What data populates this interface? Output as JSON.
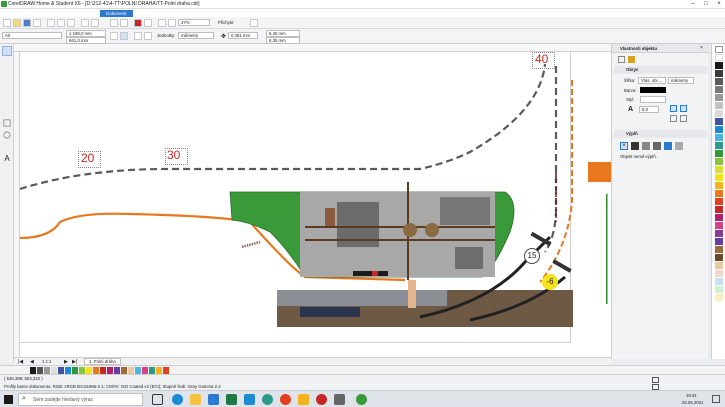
{
  "titlebar": {
    "title": "CorelDRAW Home & Student X6 - [D:\\212-41\\4-TT\\POLNI DRAHA\\TT-Polni draha.cdr]"
  },
  "tabs": {
    "active": "Dokument"
  },
  "toolbar1": {
    "zoom": "37%",
    "snap": "Přichytit"
  },
  "toolbar2": {
    "page_size": "A0",
    "width": "1 189,0 mm",
    "height": "841,0 mm",
    "units_label": "Jednotky:",
    "units": "milimetry",
    "nudge": "0,381 mm",
    "dup_x": "6,35 mm",
    "dup_y": "6,35 mm"
  },
  "canvas": {
    "labels": [
      "20",
      "30",
      "40"
    ],
    "markers": [
      "15",
      "-6"
    ]
  },
  "docker": {
    "title": "Vlastnosti objektu",
    "section_outline": "Obrys",
    "width_label": "Šířka:",
    "width_value": "Vlas. obr....",
    "width_units": "milimetry",
    "color_label": "Barva:",
    "style_label": "Styl:",
    "miter_value": "5,0",
    "section_fill": "Výplň",
    "fill_note": "Objekt nemá výplň."
  },
  "pagetabs": {
    "counter": "1 z 1",
    "page_label": "1: Polní dráha"
  },
  "statusbar": {
    "coords": "( 536,388; 553,333 )",
    "profile": "Profily barev dokumentu: RGB: sRGB IEC61966-2.1; CMYK: ISO Coated v2 (ECI); Stupně šedi: Gray Gamma 2.2"
  },
  "taskbar": {
    "search_placeholder": "Sem zadejte hledaný výraz",
    "time": "19:31",
    "date": "02.05.2021"
  },
  "colors": {
    "accent": "#2b79d0",
    "label_red": "#c62828",
    "track_orange": "#e8771e",
    "grass": "#3a9a3a",
    "track_dark": "#555555"
  }
}
